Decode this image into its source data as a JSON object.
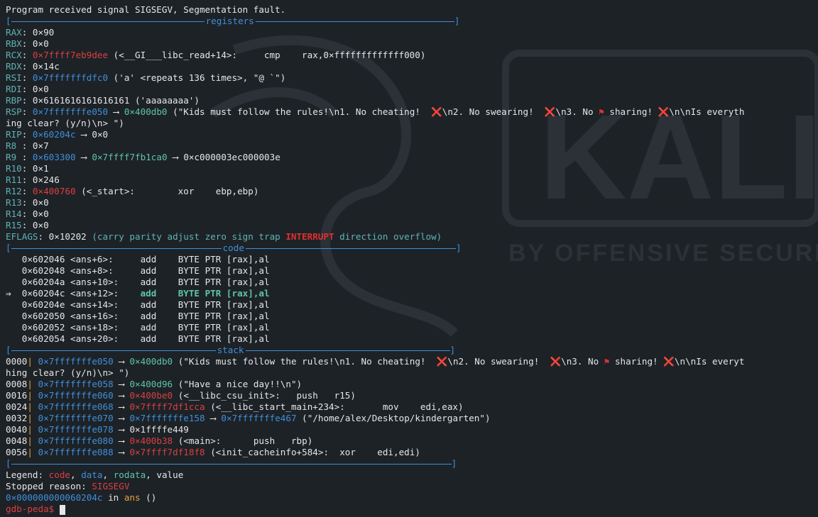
{
  "header_line": "Program received signal SIGSEGV, Segmentation fault.",
  "sections": {
    "registers": "registers",
    "code": "code",
    "stack": "stack"
  },
  "registers": {
    "rax": {
      "name": "RAX",
      "val": "0×90"
    },
    "rbx": {
      "name": "RBX",
      "val": "0×0"
    },
    "rcx": {
      "name": "RCX",
      "addr": "0×7ffff7eb9dee",
      "sym": "(<__GI___libc_read+14>:     cmp    rax,0×fffffffffffff000)"
    },
    "rdx": {
      "name": "RDX",
      "val": "0×14c"
    },
    "rsi": {
      "name": "RSI",
      "addr": "0×7fffffffdfc0",
      "sym": "('a' <repeats 136 times>, \"@ `\")"
    },
    "rdi": {
      "name": "RDI",
      "val": "0×0"
    },
    "rbp": {
      "name": "RBP",
      "val": "0×6161616161616161 ('aaaaaaaa')"
    },
    "rsp": {
      "name": "RSP",
      "addr": "0×7fffffffe050",
      "arrow": "⟶",
      "ptr": "0×400db0",
      "str1": "(\"Kids must follow the rules!\\n1. No cheating!  ",
      "x1": "❌",
      "str2": "\\n2. No swearing!  ",
      "x2": "❌",
      "str3": "\\n3. No",
      "flag": "⚑",
      "str4": " sharing! ",
      "x3": "❌",
      "str5": "\\n\\nIs everyth",
      "wrap": "ing clear? (y/n)\\n> \")"
    },
    "rip": {
      "name": "RIP",
      "addr": "0×60204c",
      "arrow": "⟶",
      "val": "0×0"
    },
    "r8": {
      "name": "R8 ",
      "val": "0×7"
    },
    "r9": {
      "name": "R9 ",
      "addr": "0×603300",
      "arrow": "⟶",
      "ptr": "0×7ffff7fb1ca0",
      "arrow2": "⟶",
      "val": "0×c000003ec000003e"
    },
    "r10": {
      "name": "R10",
      "val": "0×1"
    },
    "r11": {
      "name": "R11",
      "val": "0×246"
    },
    "r12": {
      "name": "R12",
      "addr": "0×400760",
      "sym": "(<_start>:        xor    ebp,ebp)"
    },
    "r13": {
      "name": "R13",
      "val": "0×0"
    },
    "r14": {
      "name": "R14",
      "val": "0×0"
    },
    "r15": {
      "name": "R15",
      "val": "0×0"
    },
    "eflags": {
      "name": "EFLAGS",
      "val": "0×10202",
      "open": "(",
      "flags_pre": "carry parity adjust zero sign trap",
      "flag_hi": "INTERRUPT",
      "flags_post": "direction overflow",
      "close": ")"
    }
  },
  "code": [
    {
      "marker": "   ",
      "addr": "0×602046",
      "sym": "<ans+6>:  ",
      "op": "add",
      "args": "BYTE PTR [rax],al",
      "current": false
    },
    {
      "marker": "   ",
      "addr": "0×602048",
      "sym": "<ans+8>:  ",
      "op": "add",
      "args": "BYTE PTR [rax],al",
      "current": false
    },
    {
      "marker": "   ",
      "addr": "0×60204a",
      "sym": "<ans+10>: ",
      "op": "add",
      "args": "BYTE PTR [rax],al",
      "current": false
    },
    {
      "marker": "⇒  ",
      "addr": "0×60204c",
      "sym": "<ans+12>: ",
      "op": "add",
      "args": "BYTE PTR [rax],al",
      "current": true
    },
    {
      "marker": "   ",
      "addr": "0×60204e",
      "sym": "<ans+14>: ",
      "op": "add",
      "args": "BYTE PTR [rax],al",
      "current": false
    },
    {
      "marker": "   ",
      "addr": "0×602050",
      "sym": "<ans+16>: ",
      "op": "add",
      "args": "BYTE PTR [rax],al",
      "current": false
    },
    {
      "marker": "   ",
      "addr": "0×602052",
      "sym": "<ans+18>: ",
      "op": "add",
      "args": "BYTE PTR [rax],al",
      "current": false
    },
    {
      "marker": "   ",
      "addr": "0×602054",
      "sym": "<ans+20>: ",
      "op": "add",
      "args": "BYTE PTR [rax],al",
      "current": false
    }
  ],
  "stack": {
    "s0": {
      "off": "0000",
      "addr": "0×7fffffffe050",
      "arrow": "⟶",
      "ptr": "0×400db0",
      "str1": "(\"Kids must follow the rules!\\n1. No cheating!  ",
      "x1": "❌",
      "str2": "\\n2. No swearing!  ",
      "x2": "❌",
      "str3": "\\n3. No",
      "flag": "⚑",
      "str4": " sharing! ",
      "x3": "❌",
      "str5": "\\n\\nIs everyt",
      "wrap": "hing clear? (y/n)\\n> \")"
    },
    "s1": {
      "off": "0008",
      "addr": "0×7fffffffe058",
      "arrow": "⟶",
      "ptr": "0×400d96",
      "rest": "(\"Have a nice day!!\\n\")"
    },
    "s2": {
      "off": "0016",
      "addr": "0×7fffffffe060",
      "arrow": "⟶",
      "ptr": "0×400be0",
      "rest": "(<__libc_csu_init>:   push   r15)"
    },
    "s3": {
      "off": "0024",
      "addr": "0×7fffffffe068",
      "arrow": "⟶",
      "ptr": "0×7ffff7df1cca",
      "rest": "(<__libc_start_main+234>:       mov    edi,eax)"
    },
    "s4": {
      "off": "0032",
      "addr": "0×7fffffffe070",
      "arrow": "⟶",
      "ptr": "0×7fffffffe158",
      "arrow2": "⟶",
      "ptr2": "0×7fffffffe467",
      "rest": "(\"/home/alex/Desktop/kindergarten\")"
    },
    "s5": {
      "off": "0040",
      "addr": "0×7fffffffe078",
      "arrow": "⟶",
      "rest": "0×1ffffe449"
    },
    "s6": {
      "off": "0048",
      "addr": "0×7fffffffe080",
      "arrow": "⟶",
      "ptr": "0×400b38",
      "rest": "(<main>:      push   rbp)"
    },
    "s7": {
      "off": "0056",
      "addr": "0×7fffffffe088",
      "arrow": "⟶",
      "ptr": "0×7ffff7df18f8",
      "rest": "(<init_cacheinfo+584>:  xor    edi,edi)"
    }
  },
  "footer": {
    "legend_label": "Legend: ",
    "legend_code": "code",
    "legend_data": "data",
    "legend_rodata": "rodata",
    "legend_value": "value",
    "comma": ", ",
    "stopped_label": "Stopped reason: ",
    "stopped_val": "SIGSEGV",
    "loc_addr": "0×000000000060204c",
    "loc_in": " in ",
    "loc_fn": "ans",
    "loc_args": " ()",
    "prompt": "gdb-peda$ "
  },
  "watermark": {
    "logo_text": "KALI",
    "tagline": "BY OFFENSIVE SECURITY"
  }
}
